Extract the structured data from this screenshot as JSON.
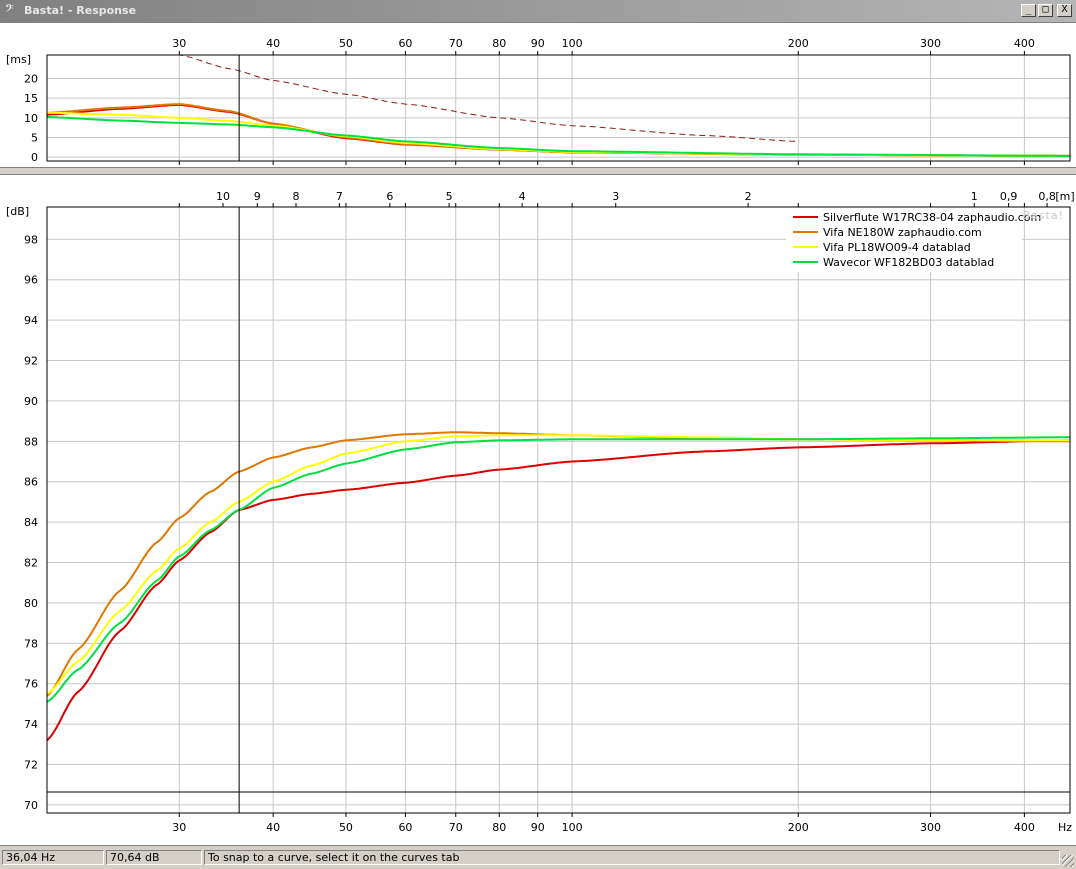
{
  "window": {
    "title": "Basta! - Response",
    "icon": "bass-clef-icon",
    "buttons": {
      "minimize": "_",
      "maximize": "□",
      "close": "X"
    }
  },
  "watermark": "Basta!",
  "colors": {
    "plot_frame": "#000000",
    "grid": "#c8c8c8",
    "silverflute": "#dd0000",
    "vifa_ne180w": "#e07800",
    "vifa_pl18": "#ffff00",
    "wavecor": "#00e040",
    "delay_dashed": "#8b1a1a"
  },
  "status": {
    "frequency": "36,04 Hz",
    "level": "70,64 dB",
    "hint": "To snap to a curve, select it on the curves tab"
  },
  "chart_data": [
    {
      "type": "line",
      "ylabel": "[ms]",
      "xlabel": "",
      "xscale": "log",
      "xlim": [
        20,
        460
      ],
      "ylim": [
        -1,
        26
      ],
      "x_ticks": [
        30,
        40,
        50,
        60,
        70,
        80,
        90,
        100,
        200,
        300,
        400
      ],
      "y_ticks": [
        0,
        5,
        10,
        15,
        20
      ],
      "cursor_x": 36.04,
      "series": [
        {
          "name": "Silverflute W17RC38-04 zaphaudio.com",
          "color": "#dd0000",
          "x": [
            20,
            25,
            30,
            35,
            40,
            50,
            60,
            80,
            100,
            200,
            460
          ],
          "y": [
            10.8,
            12.3,
            13.3,
            11.5,
            8.5,
            4.8,
            3.2,
            1.9,
            1.2,
            0.6,
            0.3
          ]
        },
        {
          "name": "Vifa NE180W zaphaudio.com",
          "color": "#e07800",
          "x": [
            20,
            25,
            30,
            35,
            40,
            50,
            60,
            80,
            100,
            200,
            460
          ],
          "y": [
            11.3,
            12.6,
            13.5,
            11.7,
            8.5,
            5.0,
            3.3,
            1.9,
            1.2,
            0.6,
            0.3
          ]
        },
        {
          "name": "Vifa PL18WO09-4 datablad",
          "color": "#ffff00",
          "x": [
            20,
            25,
            30,
            35,
            40,
            50,
            60,
            80,
            100,
            200,
            460
          ],
          "y": [
            11.3,
            10.8,
            10.0,
            9.2,
            8.0,
            5.3,
            3.6,
            2.0,
            1.3,
            0.6,
            0.3
          ]
        },
        {
          "name": "Wavecor WF182BD03 datablad",
          "color": "#00e040",
          "x": [
            20,
            25,
            30,
            35,
            40,
            50,
            60,
            80,
            100,
            200,
            460
          ],
          "y": [
            10.2,
            9.3,
            8.7,
            8.3,
            7.6,
            5.5,
            4.0,
            2.3,
            1.5,
            0.7,
            0.3
          ]
        },
        {
          "name": "",
          "color": "#8b1a1a",
          "dashed": true,
          "x": [
            20,
            30,
            35,
            40,
            50,
            60,
            80,
            100,
            150,
            200
          ],
          "y": [
            26,
            26,
            22.5,
            19.5,
            16.0,
            13.5,
            10.0,
            8.0,
            5.5,
            4.0
          ]
        }
      ]
    },
    {
      "type": "line",
      "ylabel": "[dB]",
      "xlabel": "Hz",
      "xscale": "log",
      "xlim": [
        20,
        460
      ],
      "ylim": [
        69.6,
        99.6
      ],
      "x_ticks": [
        30,
        40,
        50,
        60,
        70,
        80,
        90,
        100,
        200,
        300,
        400
      ],
      "y_ticks": [
        70,
        72,
        74,
        76,
        78,
        80,
        82,
        84,
        86,
        88,
        90,
        92,
        94,
        96,
        98
      ],
      "top_axis_label": "[m]",
      "top_axis_ticks": [
        "10",
        "9",
        "8",
        "7",
        "6",
        "5",
        "4",
        "3",
        "2",
        "1",
        "0,9",
        "0,8"
      ],
      "top_axis_tick_freqs": [
        34.3,
        38.1,
        42.9,
        49.0,
        57.2,
        68.6,
        85.8,
        114.3,
        171.5,
        343,
        381.1,
        428.8
      ],
      "cursor_x": 36.04,
      "cursor_y": 70.64,
      "legend": "top-right",
      "series": [
        {
          "name": "Silverflute W17RC38-04 zaphaudio.com",
          "color": "#dd0000",
          "x": [
            20,
            22,
            25,
            28,
            30,
            33,
            36,
            40,
            45,
            50,
            60,
            70,
            80,
            100,
            150,
            200,
            300,
            460
          ],
          "y": [
            73.2,
            75.6,
            78.6,
            80.9,
            82.1,
            83.5,
            84.6,
            85.1,
            85.4,
            85.6,
            85.95,
            86.3,
            86.6,
            87.0,
            87.5,
            87.7,
            87.9,
            88.05
          ]
        },
        {
          "name": "Vifa NE180W zaphaudio.com",
          "color": "#e07800",
          "x": [
            20,
            22,
            25,
            28,
            30,
            33,
            36,
            40,
            45,
            50,
            60,
            70,
            80,
            100,
            150,
            200,
            300,
            460
          ],
          "y": [
            75.4,
            77.7,
            80.6,
            83.0,
            84.2,
            85.5,
            86.5,
            87.2,
            87.7,
            88.05,
            88.35,
            88.45,
            88.4,
            88.3,
            88.15,
            88.1,
            88.05,
            88.0
          ]
        },
        {
          "name": "Vifa PL18WO09-4 datablad",
          "color": "#ffff00",
          "x": [
            20,
            22,
            25,
            28,
            30,
            33,
            36,
            40,
            45,
            50,
            60,
            70,
            80,
            100,
            150,
            200,
            300,
            460
          ],
          "y": [
            75.5,
            77.1,
            79.6,
            81.6,
            82.7,
            84.0,
            85.0,
            86.0,
            86.8,
            87.4,
            88.0,
            88.25,
            88.3,
            88.3,
            88.2,
            88.1,
            88.05,
            88.05
          ]
        },
        {
          "name": "Wavecor WF182BD03 datablad",
          "color": "#00e040",
          "x": [
            20,
            22,
            25,
            28,
            30,
            33,
            36,
            40,
            45,
            50,
            60,
            70,
            80,
            100,
            150,
            200,
            300,
            460
          ],
          "y": [
            75.1,
            76.7,
            79.0,
            81.1,
            82.3,
            83.6,
            84.6,
            85.7,
            86.4,
            86.9,
            87.6,
            87.95,
            88.05,
            88.1,
            88.1,
            88.1,
            88.15,
            88.2
          ]
        }
      ]
    }
  ]
}
